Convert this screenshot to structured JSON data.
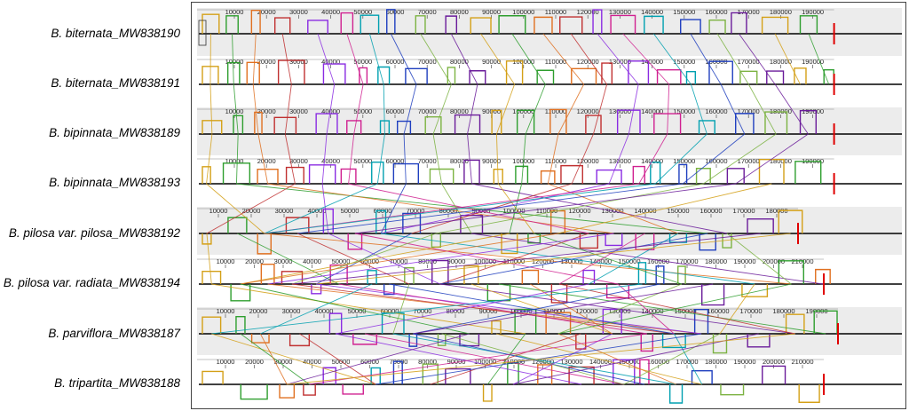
{
  "genomes": [
    {
      "label": "B. biternata_MW838190",
      "tick_start": 10000,
      "tick_end": 190000
    },
    {
      "label": "B. biternata_MW838191",
      "tick_start": 10000,
      "tick_end": 190000
    },
    {
      "label": "B. bipinnata_MW838189",
      "tick_start": 10000,
      "tick_end": 190000
    },
    {
      "label": "B. bipinnata_MW838193",
      "tick_start": 10000,
      "tick_end": 190000
    },
    {
      "label": "B. pilosa var. pilosa_MW838192",
      "tick_start": 10000,
      "tick_end": 180000
    },
    {
      "label": "B. pilosa var. radiata_MW838194",
      "tick_start": 10000,
      "tick_end": 210000
    },
    {
      "label": "B. parviflora_MW838187",
      "tick_start": 10000,
      "tick_end": 190000
    },
    {
      "label": "B. tripartita_MW838188",
      "tick_start": 10000,
      "tick_end": 210000
    }
  ],
  "tick_step": 10000,
  "block_colors": [
    "#d4a017",
    "#2e9e2e",
    "#e07020",
    "#c03030",
    "#8a2be2",
    "#d02090",
    "#00a0b0",
    "#1f3fbf",
    "#7cb342",
    "#6a1b9a"
  ]
}
